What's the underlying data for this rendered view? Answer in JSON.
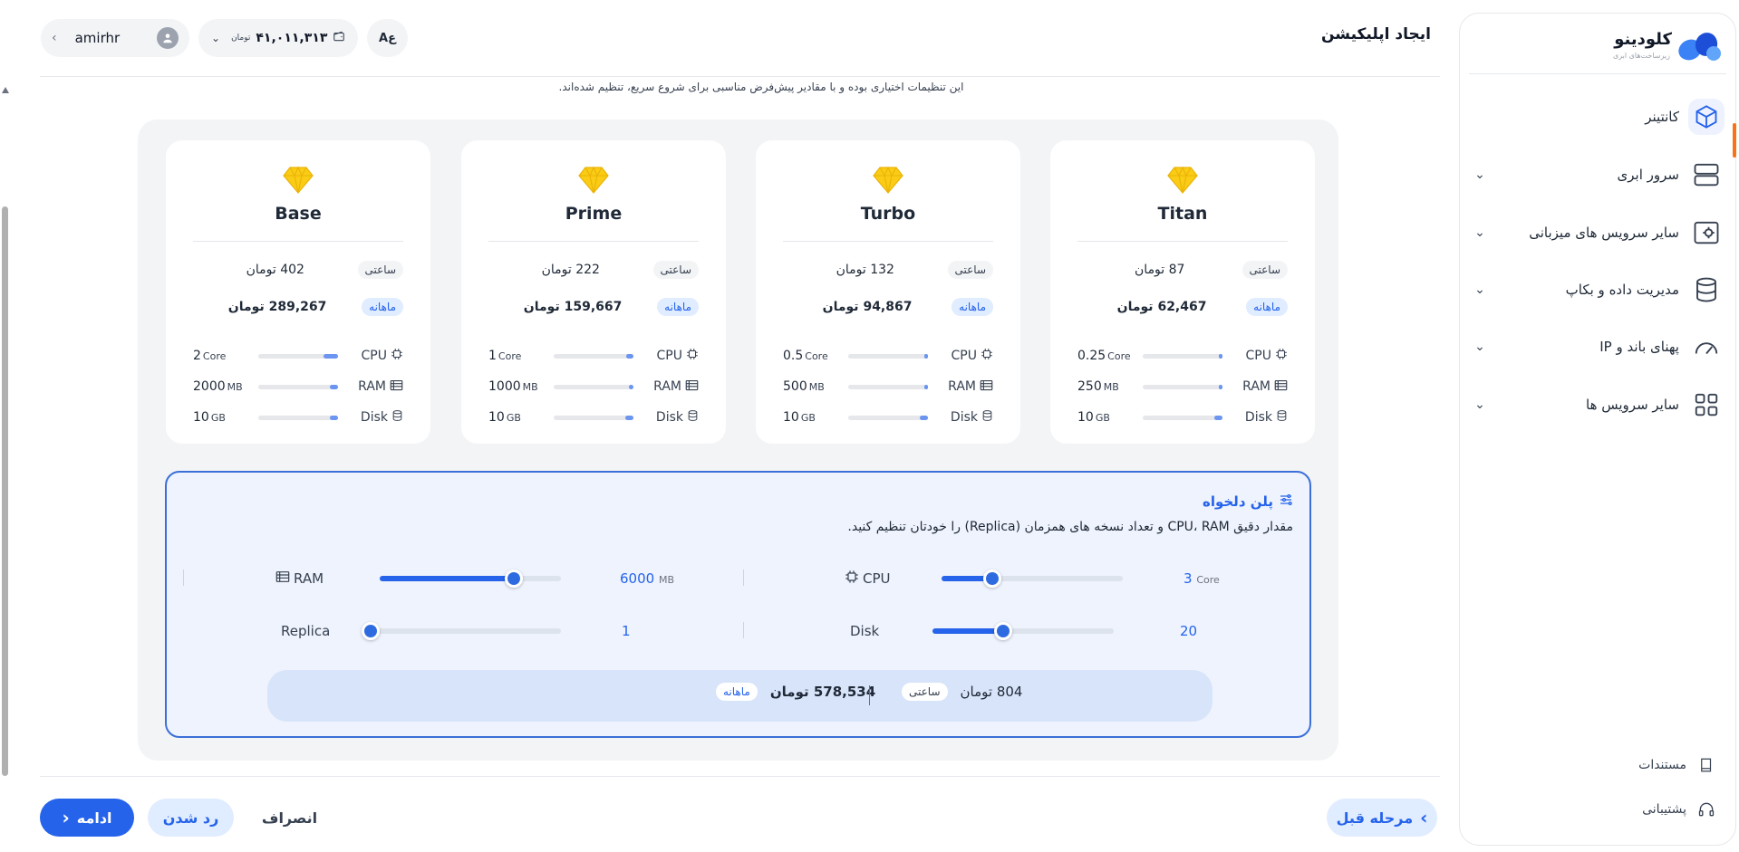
{
  "header": {
    "page_title": "ایجاد اپلیکیشن",
    "hint": "این تنظیمات اختیاری بوده و با مقادیر پیش‌فرض مناسبی برای شروع سریع، تنظیم شده‌اند.",
    "username": "amirhr",
    "wallet_amount": "۴۱,۰۱۱,۳۱۳",
    "wallet_currency": "تومان",
    "lang_label": "Aع"
  },
  "sidebar": {
    "brand": "کلودینو",
    "brand_sub": "زیرساخت‌های ابری",
    "items": [
      {
        "label": "کانتینر",
        "icon": "container-cube-icon"
      },
      {
        "label": "سرور ابری",
        "icon": "server-icon"
      },
      {
        "label": "سایر سرویس های میزبانی",
        "icon": "hosting-services-icon"
      },
      {
        "label": "مدیریت داده و بکاپ",
        "icon": "database-icon"
      },
      {
        "label": "پهنای باند و IP",
        "icon": "speedometer-icon"
      },
      {
        "label": "سایر سرویس ها",
        "icon": "grid-icon"
      }
    ],
    "docs_label": "مستندات",
    "support_label": "پشتیبانی"
  },
  "plans": [
    {
      "name": "Base",
      "hourly": "402 تومان",
      "monthly": "289,267 تومان",
      "cpu": "2",
      "cpu_unit": "Core",
      "cpu_level": 0.18,
      "ram": "2000",
      "ram_unit": "MB",
      "ram_level": 0.1,
      "disk": "10",
      "disk_unit": "GB",
      "disk_level": 0.1
    },
    {
      "name": "Prime",
      "hourly": "222 تومان",
      "monthly": "159,667 تومان",
      "cpu": "1",
      "cpu_unit": "Core",
      "cpu_level": 0.09,
      "ram": "1000",
      "ram_unit": "MB",
      "ram_level": 0.06,
      "disk": "10",
      "disk_unit": "GB",
      "disk_level": 0.1
    },
    {
      "name": "Turbo",
      "hourly": "132 تومان",
      "monthly": "94,867 تومان",
      "cpu": "0.5",
      "cpu_unit": "Core",
      "cpu_level": 0.04,
      "ram": "500",
      "ram_unit": "MB",
      "ram_level": 0.03,
      "disk": "10",
      "disk_unit": "GB",
      "disk_level": 0.1
    },
    {
      "name": "Titan",
      "hourly": "87 تومان",
      "monthly": "62,467 تومان",
      "cpu": "0.25",
      "cpu_unit": "Core",
      "cpu_level": 0.02,
      "ram": "250",
      "ram_unit": "MB",
      "ram_level": 0.02,
      "disk": "10",
      "disk_unit": "GB",
      "disk_level": 0.1
    }
  ],
  "labels": {
    "hourly": "ساعتی",
    "monthly": "ماهانه",
    "cpu": "CPU",
    "ram": "RAM",
    "disk": "Disk",
    "replica": "Replica"
  },
  "custom_plan": {
    "title": "پلن دلخواه",
    "description": "مقدار دقیق CPU، RAM و تعداد نسخه های همزمان (Replica) را خودتان تنظیم کنید.",
    "ram_value": "6000",
    "ram_unit": "MB",
    "ram_level": 0.74,
    "cpu_value": "3",
    "cpu_unit": "Core",
    "cpu_level": 0.28,
    "replica_value": "1",
    "replica_level": 0.0,
    "disk_value": "20",
    "disk_level": 0.39,
    "summary_hourly": "804 تومان",
    "summary_monthly": "578,534 تومان"
  },
  "footer": {
    "continue_label": "ادامه",
    "reject_label": "رد شدن",
    "cancel_label": "انصراف",
    "prev_label": "مرحله قبل"
  },
  "colors": {
    "primary": "#2563eb",
    "accent_orange": "#f97316",
    "gem_yellow": "#facc15"
  }
}
